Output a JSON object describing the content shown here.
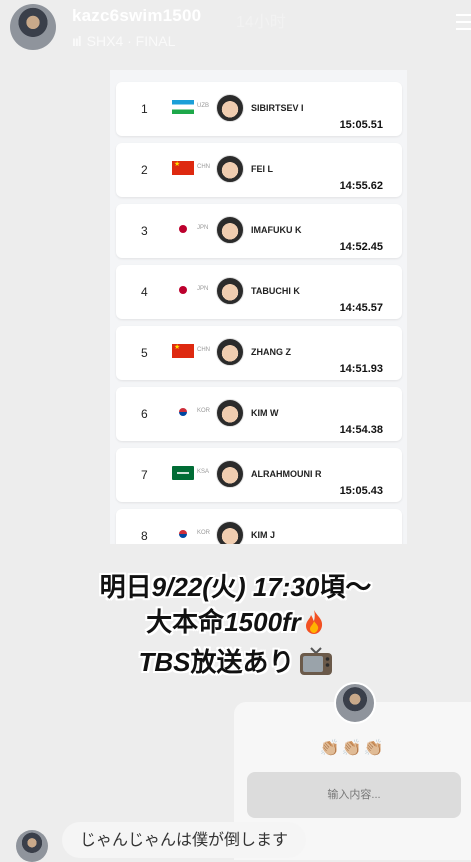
{
  "story": {
    "username": "kazc6swim1500",
    "time": "14小时",
    "music_bars": "ııl",
    "music": "SHX4 · FINAL"
  },
  "results": [
    {
      "rank": "1",
      "flag": "uzb",
      "country": "UZB",
      "name": "SIBIRTSEV I",
      "time": "15:05.51"
    },
    {
      "rank": "2",
      "flag": "chn",
      "country": "CHN",
      "name": "FEI L",
      "time": "14:55.62"
    },
    {
      "rank": "3",
      "flag": "jpn",
      "country": "JPN",
      "name": "IMAFUKU K",
      "time": "14:52.45"
    },
    {
      "rank": "4",
      "flag": "jpn",
      "country": "JPN",
      "name": "TABUCHI K",
      "time": "14:45.57"
    },
    {
      "rank": "5",
      "flag": "chn",
      "country": "CHN",
      "name": "ZHANG Z",
      "time": "14:51.93"
    },
    {
      "rank": "6",
      "flag": "kor",
      "country": "KOR",
      "name": "KIM W",
      "time": "14:54.38"
    },
    {
      "rank": "7",
      "flag": "ksa",
      "country": "KSA",
      "name": "ALRAHMOUNI R",
      "time": "15:05.43"
    },
    {
      "rank": "8",
      "flag": "kor",
      "country": "KOR",
      "name": "KIM J",
      "time": ""
    }
  ],
  "caption": {
    "line1_a": "明日",
    "line1_b": "9/22(",
    "line1_c": "火",
    "line1_d": ") 17:30",
    "line1_e": "頃〜",
    "line2_a": "大本命",
    "line2_b": "1500fr",
    "line3_a": "TBS",
    "line3_b": "放送あり"
  },
  "reply": {
    "reactions": "👏🏼👏🏼👏🏼",
    "placeholder": "输入内容..."
  },
  "comment": {
    "text": "じゃんじゃんは僕が倒します"
  },
  "colors": {
    "background": "#ededed",
    "card": "#ffffff",
    "reply_input": "#dcdcdc"
  }
}
